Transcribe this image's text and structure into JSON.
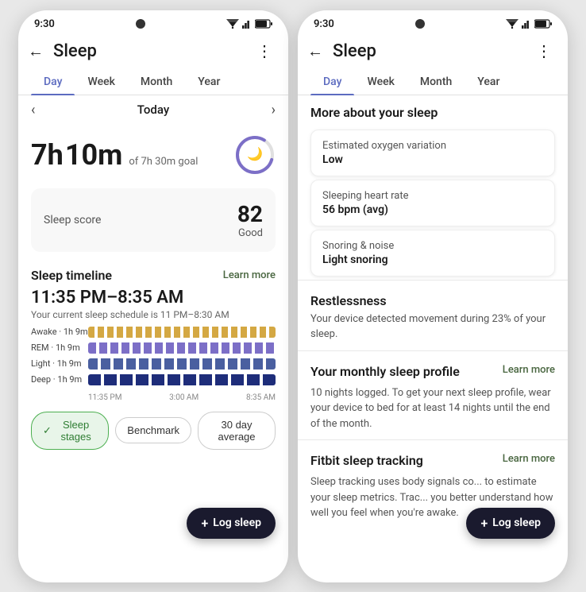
{
  "left_phone": {
    "status_bar": {
      "time": "9:30",
      "icons": "▲◀▌"
    },
    "header": {
      "back_label": "←",
      "title": "Sleep",
      "more_label": "⋮"
    },
    "tabs": [
      "Day",
      "Week",
      "Month",
      "Year"
    ],
    "active_tab": "Day",
    "date_nav": {
      "prev": "‹",
      "label": "Today",
      "next": "›"
    },
    "duration": {
      "hours": "7h",
      "minutes": "10m",
      "goal_text": "of 7h 30m goal"
    },
    "sleep_score": {
      "label": "Sleep score",
      "value": "82",
      "quality": "Good"
    },
    "timeline": {
      "section_label": "Sleep timeline",
      "learn_more": "Learn more",
      "time_range": "11:35 PM–8:35 AM",
      "subtitle": "Your current sleep schedule is 11 PM–8:30 AM"
    },
    "chart_rows": [
      {
        "label": "Awake · 1h 9m",
        "type": "awake"
      },
      {
        "label": "REM · 1h 9m",
        "type": "rem"
      },
      {
        "label": "Light · 1h 9m",
        "type": "light"
      },
      {
        "label": "Deep · 1h 9m",
        "type": "deep"
      }
    ],
    "chart_times": [
      "11:35 PM",
      "3:00 AM",
      "8:35 AM"
    ],
    "bottom_buttons": [
      "Sleep stages",
      "Benchmark",
      "30 day average"
    ],
    "fab_label": "Log sleep"
  },
  "right_phone": {
    "status_bar": {
      "time": "9:30"
    },
    "header": {
      "back_label": "←",
      "title": "Sleep",
      "more_label": "⋮"
    },
    "tabs": [
      "Day",
      "Week",
      "Month",
      "Year"
    ],
    "active_tab": "Day",
    "more_sleep_title": "More about your sleep",
    "metrics": [
      {
        "name": "Estimated oxygen variation",
        "value": "Low"
      },
      {
        "name": "Sleeping heart rate",
        "value": "56 bpm (avg)"
      },
      {
        "name": "Snoring & noise",
        "value": "Light snoring"
      }
    ],
    "restlessness": {
      "title": "Restlessness",
      "text": "Your device detected movement during 23% of your sleep."
    },
    "monthly_profile": {
      "title": "Your monthly sleep profile",
      "learn_more": "Learn more",
      "text": "10 nights logged. To get your next sleep profile, wear your device to bed for at least 14 nights until the end of the month."
    },
    "fitbit_tracking": {
      "title": "Fitbit sleep tracking",
      "learn_more": "Learn more",
      "text": "Sleep tracking uses body signals co... to estimate your sleep metrics. Trac... you better understand how well you feel when you're awake."
    },
    "fab_label": "Log sleep"
  }
}
